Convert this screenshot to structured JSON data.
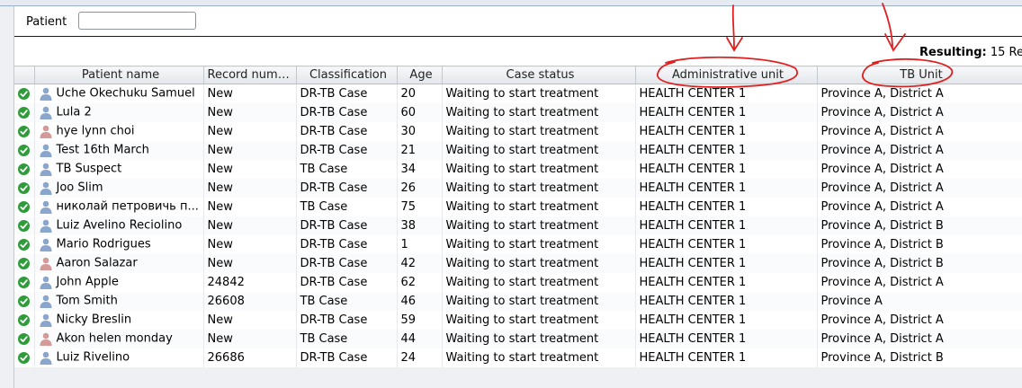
{
  "filter": {
    "label": "Patient",
    "value": ""
  },
  "result": {
    "label": "Resulting:",
    "text": "15 Re"
  },
  "columns": [
    "",
    "Patient name",
    "Record number",
    "Classification",
    "Age",
    "Case status",
    "Administrative unit",
    "TB Unit"
  ],
  "rows": [
    {
      "name": "Uche Okechuku Samuel",
      "record": "New",
      "classification": "DR-TB Case",
      "age": "20",
      "status": "Waiting to start treatment",
      "admin": "HEALTH CENTER 1",
      "tb": "Province A, District A",
      "gender": "male"
    },
    {
      "name": "Lula 2",
      "record": "New",
      "classification": "DR-TB Case",
      "age": "60",
      "status": "Waiting to start treatment",
      "admin": "HEALTH CENTER 1",
      "tb": "Province A, District A",
      "gender": "male"
    },
    {
      "name": "hye lynn choi",
      "record": "New",
      "classification": "DR-TB Case",
      "age": "30",
      "status": "Waiting to start treatment",
      "admin": "HEALTH CENTER 1",
      "tb": "Province A, District A",
      "gender": "female"
    },
    {
      "name": "Test 16th March",
      "record": "New",
      "classification": "DR-TB Case",
      "age": "21",
      "status": "Waiting to start treatment",
      "admin": "HEALTH CENTER 1",
      "tb": "Province A, District A",
      "gender": "male"
    },
    {
      "name": "TB Suspect",
      "record": "New",
      "classification": "TB Case",
      "age": "34",
      "status": "Waiting to start treatment",
      "admin": "HEALTH CENTER 1",
      "tb": "Province A, District A",
      "gender": "male"
    },
    {
      "name": "Joo Slim",
      "record": "New",
      "classification": "DR-TB Case",
      "age": "26",
      "status": "Waiting to start treatment",
      "admin": "HEALTH CENTER 1",
      "tb": "Province A, District A",
      "gender": "male"
    },
    {
      "name": "николай петровичь п...",
      "record": "New",
      "classification": "TB Case",
      "age": "75",
      "status": "Waiting to start treatment",
      "admin": "HEALTH CENTER 1",
      "tb": "Province A, District A",
      "gender": "male"
    },
    {
      "name": "Luiz Avelino Reciolino",
      "record": "New",
      "classification": "DR-TB Case",
      "age": "38",
      "status": "Waiting to start treatment",
      "admin": "HEALTH CENTER 1",
      "tb": "Province A, District B",
      "gender": "male"
    },
    {
      "name": "Mario Rodrigues",
      "record": "New",
      "classification": "DR-TB Case",
      "age": "1",
      "status": "Waiting to start treatment",
      "admin": "HEALTH CENTER 1",
      "tb": "Province A, District B",
      "gender": "male"
    },
    {
      "name": "Aaron Salazar",
      "record": "New",
      "classification": "DR-TB Case",
      "age": "42",
      "status": "Waiting to start treatment",
      "admin": "HEALTH CENTER 1",
      "tb": "Province A, District B",
      "gender": "female"
    },
    {
      "name": "John Apple",
      "record": "24842",
      "classification": "DR-TB Case",
      "age": "62",
      "status": "Waiting to start treatment",
      "admin": "HEALTH CENTER 1",
      "tb": "Province A, District A",
      "gender": "male"
    },
    {
      "name": "Tom Smith",
      "record": "26608",
      "classification": "TB Case",
      "age": "46",
      "status": "Waiting to start treatment",
      "admin": "HEALTH CENTER 1",
      "tb": "Province A",
      "gender": "male"
    },
    {
      "name": "Nicky Breslin",
      "record": "New",
      "classification": "DR-TB Case",
      "age": "59",
      "status": "Waiting to start treatment",
      "admin": "HEALTH CENTER 1",
      "tb": "Province A, District A",
      "gender": "male"
    },
    {
      "name": "Akon helen monday",
      "record": "New",
      "classification": "TB Case",
      "age": "44",
      "status": "Waiting to start treatment",
      "admin": "HEALTH CENTER 1",
      "tb": "Province A, District A",
      "gender": "female"
    },
    {
      "name": "Luiz Rivelino",
      "record": "26686",
      "classification": "DR-TB Case",
      "age": "24",
      "status": "Waiting to start treatment",
      "admin": "HEALTH CENTER 1",
      "tb": "Province A, District B",
      "gender": "male"
    }
  ],
  "colors": {
    "check": "#2f9b3a",
    "male_icon": "#8aa6cc",
    "female_icon": "#d49a9a",
    "annotation": "#e02020"
  },
  "icons": {
    "status": "check-circle-icon",
    "patient": "person-icon"
  }
}
